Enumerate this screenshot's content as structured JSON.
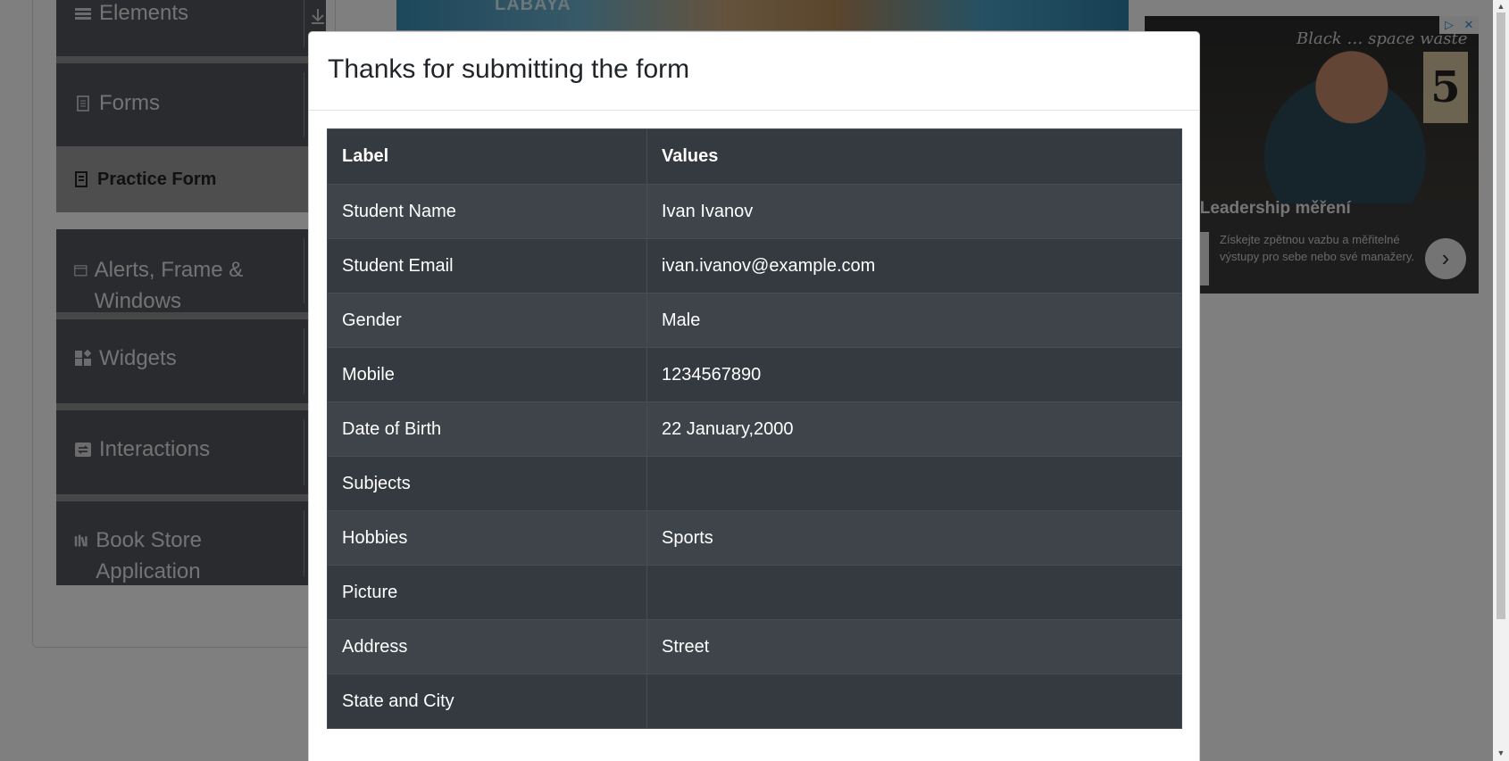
{
  "sidebar": {
    "groups": [
      {
        "label": "Elements",
        "icon": "hamburger-icon"
      },
      {
        "label": "Forms",
        "icon": "document-icon"
      },
      {
        "label": "Alerts, Frame & Windows",
        "icon": "window-icon"
      },
      {
        "label": "Widgets",
        "icon": "widgets-icon"
      },
      {
        "label": "Interactions",
        "icon": "interactions-icon"
      },
      {
        "label": "Book Store Application",
        "icon": "books-icon"
      }
    ],
    "active_item": {
      "label": "Practice Form",
      "icon": "form-icon"
    }
  },
  "banner": {
    "text": "LABAYA"
  },
  "ad": {
    "title": "oušejte Leadership měření",
    "description": "Získejte zpětnou vazbu a měřitelné výstupy pro sebe nebo své manažery.",
    "board_text": "Black … space waste",
    "board_number": "5",
    "badges": [
      "▷",
      "✕"
    ],
    "next_icon": "chevron-right-icon"
  },
  "modal": {
    "title": "Thanks for submitting the form",
    "table": {
      "headers": [
        "Label",
        "Values"
      ],
      "rows": [
        {
          "label": "Student Name",
          "value": "Ivan Ivanov"
        },
        {
          "label": "Student Email",
          "value": "ivan.ivanov@example.com"
        },
        {
          "label": "Gender",
          "value": "Male"
        },
        {
          "label": "Mobile",
          "value": "1234567890"
        },
        {
          "label": "Date of Birth",
          "value": "22 January,2000"
        },
        {
          "label": "Subjects",
          "value": ""
        },
        {
          "label": "Hobbies",
          "value": "Sports"
        },
        {
          "label": "Picture",
          "value": ""
        },
        {
          "label": "Address",
          "value": "Street"
        },
        {
          "label": "State and City",
          "value": ""
        }
      ]
    }
  },
  "colors": {
    "table_bg": "#343a40",
    "table_stripe": "#3e444a",
    "sidebar_group_bg": "#54575c",
    "active_item_bg": "#9c9c9c"
  }
}
